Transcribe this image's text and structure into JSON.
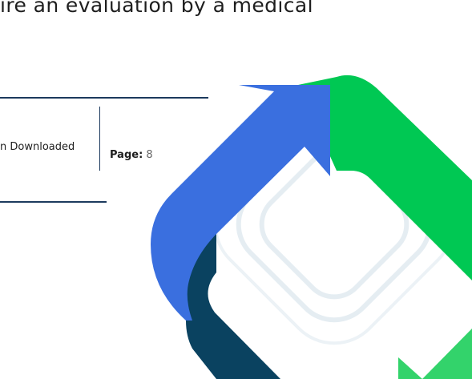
{
  "heading": {
    "text": "ire an evaluation by a medical"
  },
  "document_info": {
    "status_text": "n Downloaded",
    "page_label": "Page:",
    "page_value": "8"
  },
  "watermark": {
    "name": "brand-logo",
    "colors": {
      "blue": "#3a6fdf",
      "green": "#00c853",
      "navy": "#0a4260",
      "outline": "#d9e6ee"
    }
  }
}
